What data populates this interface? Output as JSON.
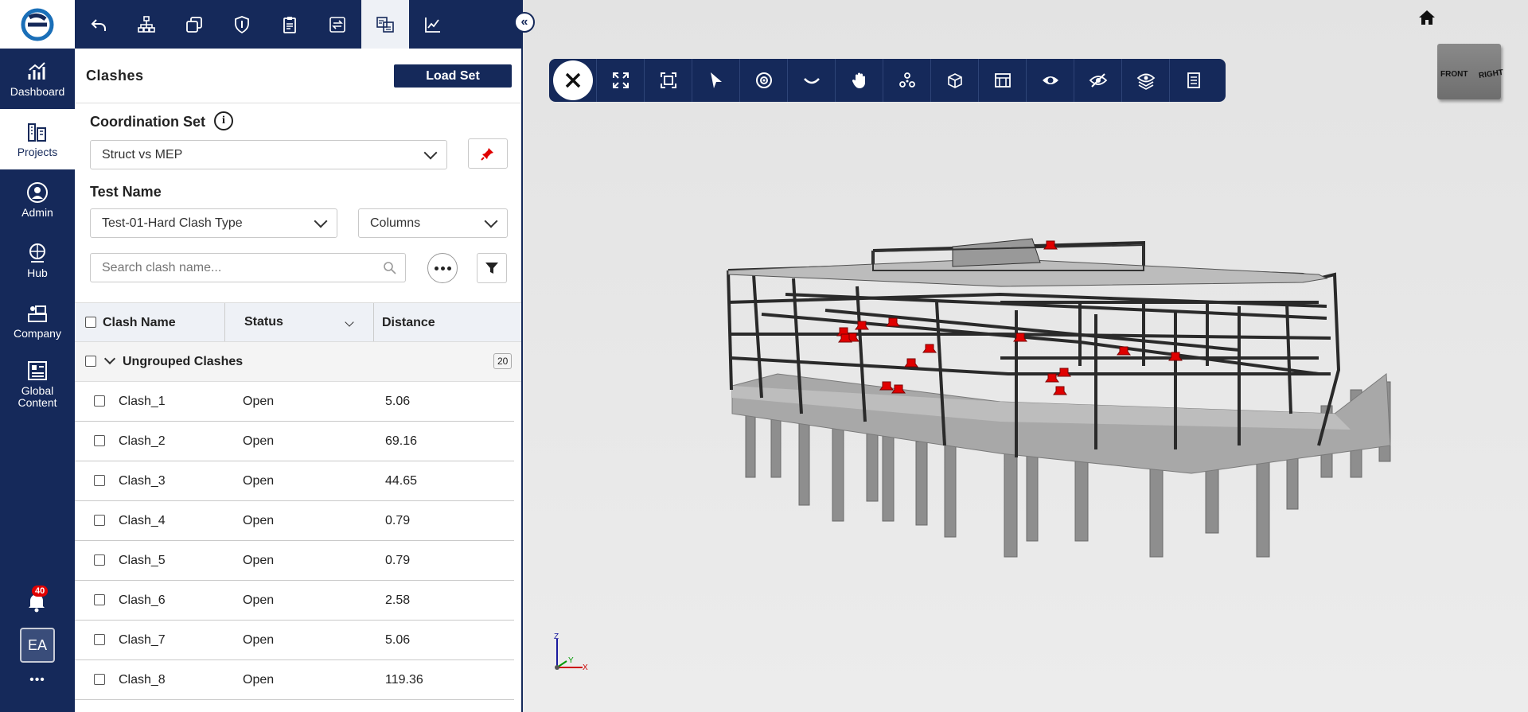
{
  "sidebar": {
    "items": [
      {
        "label": "Dashboard",
        "icon": "chart-icon"
      },
      {
        "label": "Projects",
        "icon": "buildings-icon"
      },
      {
        "label": "Admin",
        "icon": "admin-icon"
      },
      {
        "label": "Hub",
        "icon": "globe-icon"
      },
      {
        "label": "Company",
        "icon": "company-icon"
      },
      {
        "label": "Global Content",
        "icon": "content-icon"
      }
    ],
    "notifications_count": "40",
    "avatar": "EA",
    "more": "•••"
  },
  "panel": {
    "title": "Clashes",
    "load_set": "Load Set",
    "coordination_set_label": "Coordination Set",
    "coordination_set_value": "Struct vs MEP",
    "test_name_label": "Test Name",
    "test_name_value": "Test-01-Hard Clash Type",
    "filter_value": "Columns",
    "search_placeholder": "Search clash name...",
    "columns": [
      "Clash Name",
      "Status",
      "Distance"
    ],
    "group_label": "Ungrouped Clashes",
    "group_count": "20",
    "rows": [
      {
        "name": "Clash_1",
        "status": "Open",
        "distance": "5.06"
      },
      {
        "name": "Clash_2",
        "status": "Open",
        "distance": "69.16"
      },
      {
        "name": "Clash_3",
        "status": "Open",
        "distance": "44.65"
      },
      {
        "name": "Clash_4",
        "status": "Open",
        "distance": "0.79"
      },
      {
        "name": "Clash_5",
        "status": "Open",
        "distance": "0.79"
      },
      {
        "name": "Clash_6",
        "status": "Open",
        "distance": "2.58"
      },
      {
        "name": "Clash_7",
        "status": "Open",
        "distance": "5.06"
      },
      {
        "name": "Clash_8",
        "status": "Open",
        "distance": "119.36"
      }
    ]
  },
  "viewer": {
    "cube_front": "FRONT",
    "cube_right": "RIGHT",
    "axis_z": "Z",
    "axis_y": "Y",
    "axis_x": "X"
  },
  "colors": {
    "brand": "#15295a",
    "clash": "#e00000"
  }
}
